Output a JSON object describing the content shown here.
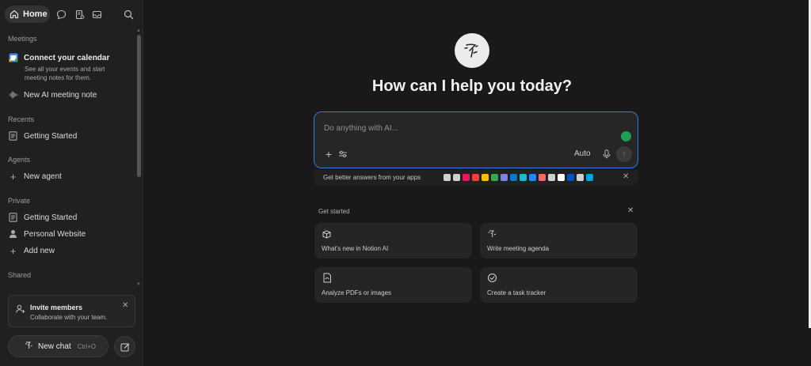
{
  "nav": {
    "home_label": "Home",
    "icons": [
      "home-icon",
      "chat-icon",
      "notes-icon",
      "inbox-icon",
      "search-icon"
    ]
  },
  "sidebar": {
    "meetings": {
      "header": "Meetings",
      "connect_title": "Connect your calendar",
      "connect_sub": "See all your events and start meeting notes for them.",
      "new_note": "New AI meeting note"
    },
    "recents": {
      "header": "Recents",
      "items": [
        "Getting Started"
      ]
    },
    "agents": {
      "header": "Agents",
      "new_agent": "New agent"
    },
    "private": {
      "header": "Private",
      "items": [
        "Getting Started",
        "Personal Website"
      ],
      "add_new": "Add new"
    },
    "shared": {
      "header": "Shared"
    }
  },
  "invite": {
    "title": "Invite members",
    "subtitle": "Collaborate with your team."
  },
  "new_chat": {
    "label": "New chat",
    "shortcut": "Ctrl+O"
  },
  "main": {
    "headline": "How can I help you today?",
    "prompt_placeholder": "Do anything with AI...",
    "mode": "Auto",
    "apps_text": "Get better answers from your apps",
    "app_colors": [
      "#cfcfcf",
      "#cfcfcf",
      "#e01e5a",
      "#ea4335",
      "#fbbc05",
      "#34a853",
      "#7b83eb",
      "#0078d4",
      "#1fb8cd",
      "#2684ff",
      "#f06a6a",
      "#cfcfcf",
      "#ffffff",
      "#0052cc",
      "#cfcfcf",
      "#00a1e0"
    ],
    "get_started_label": "Get started",
    "cards": [
      {
        "label": "What's new in Notion AI",
        "icon": "sparkle-box-icon"
      },
      {
        "label": "Write meeting agenda",
        "icon": "ai-face-icon"
      },
      {
        "label": "Analyze PDFs or images",
        "icon": "document-icon"
      },
      {
        "label": "Create a task tracker",
        "icon": "check-circle-icon"
      }
    ]
  },
  "colors": {
    "accent": "#2f7fe0",
    "background": "#191919",
    "sidebar": "#202020"
  }
}
